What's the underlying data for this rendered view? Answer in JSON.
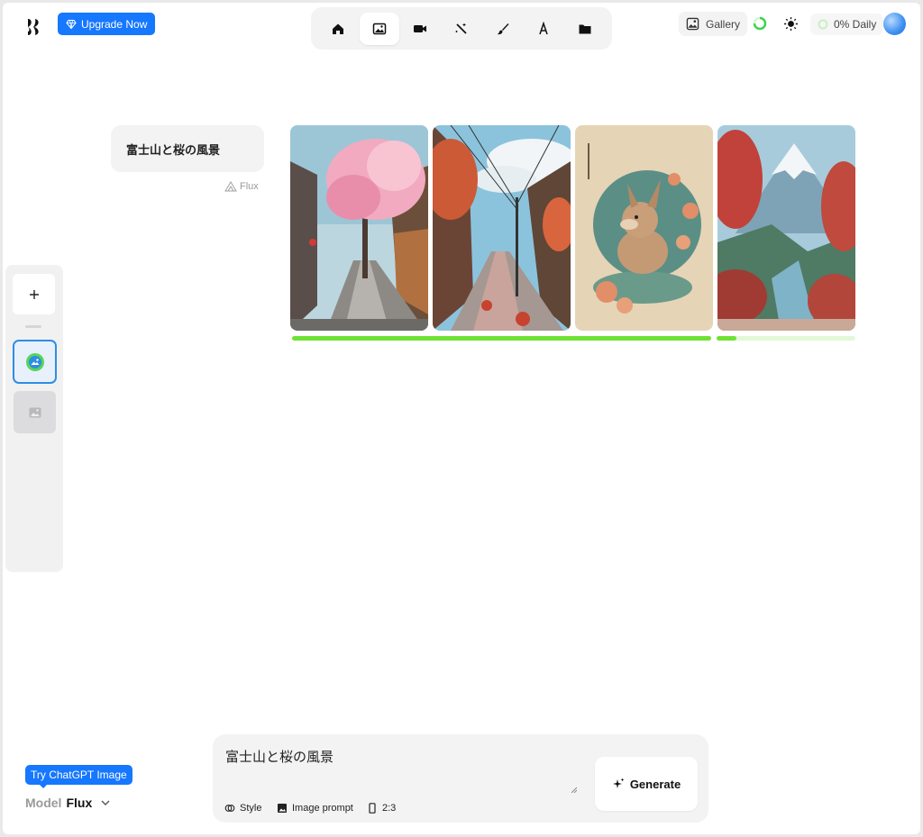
{
  "header": {
    "upgrade_label": "Upgrade Now",
    "toolbar": [
      {
        "name": "home",
        "icon": "home-icon"
      },
      {
        "name": "image",
        "icon": "image-icon",
        "active": true
      },
      {
        "name": "video",
        "icon": "video-icon"
      },
      {
        "name": "magic",
        "icon": "magic-wand-icon"
      },
      {
        "name": "edit",
        "icon": "brush-icon"
      },
      {
        "name": "text",
        "icon": "font-icon"
      },
      {
        "name": "folder",
        "icon": "folder-icon"
      }
    ],
    "gallery_label": "Gallery",
    "daily_label": "0% Daily"
  },
  "history": {
    "prompt": "富士山と桜の風景",
    "model_tag": "Flux",
    "images": [
      {
        "subject": "street with cherry blossom tree"
      },
      {
        "subject": "street with power lines and red foliage"
      },
      {
        "subject": "fox with flowers in circle"
      },
      {
        "subject": "snowy mountain with red trees"
      }
    ],
    "progress": [
      {
        "fraction": 1.0,
        "color": "#6fe234"
      },
      {
        "fraction": 0.14,
        "color": "#6fe234"
      }
    ]
  },
  "composer": {
    "prompt_value": "富士山と桜の風景",
    "style_label": "Style",
    "image_prompt_label": "Image prompt",
    "ratio_label": "2:3",
    "generate_label": "Generate"
  },
  "model_picker": {
    "tip": "Try ChatGPT Image",
    "label": "Model",
    "value": "Flux"
  },
  "colors": {
    "accent": "#1677ff",
    "progress": "#6fe234",
    "selected_border": "#2f8de4"
  }
}
